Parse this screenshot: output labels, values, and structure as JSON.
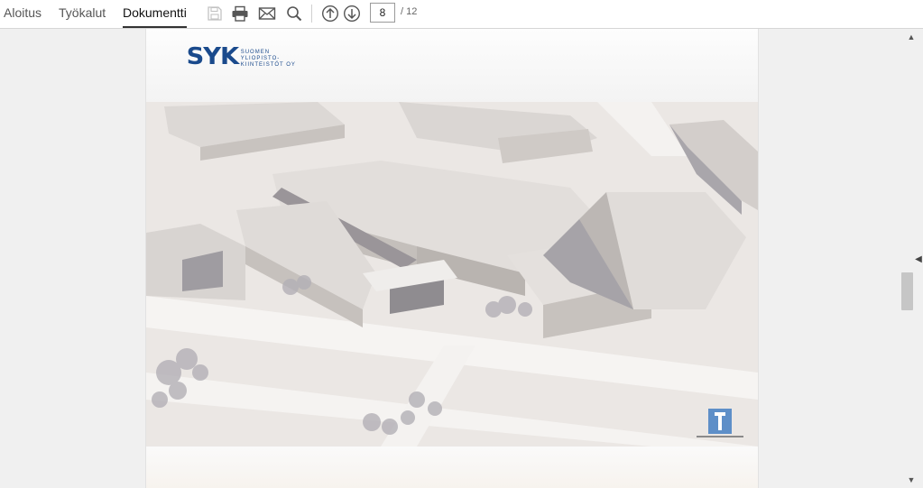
{
  "toolbar": {
    "tabs": [
      {
        "label": "Aloitus",
        "active": false
      },
      {
        "label": "Työkalut",
        "active": false
      },
      {
        "label": "Dokumentti",
        "active": true
      }
    ],
    "icons": [
      "save-icon",
      "print-icon",
      "mail-icon",
      "search-icon",
      "page-up-icon",
      "page-down-icon"
    ],
    "page_current": "8",
    "page_total": "/ 12"
  },
  "document": {
    "logo": {
      "mark": "SYK",
      "line1": "SUOMEN",
      "line2": "YLIOPISTO-",
      "line3": "KIINTEISTÖT OY"
    },
    "image": "architectural rendering"
  },
  "colors": {
    "accent": "#1a4a8c",
    "toolbar_bg": "#ffffff",
    "viewer_bg": "#f0f0f0"
  }
}
